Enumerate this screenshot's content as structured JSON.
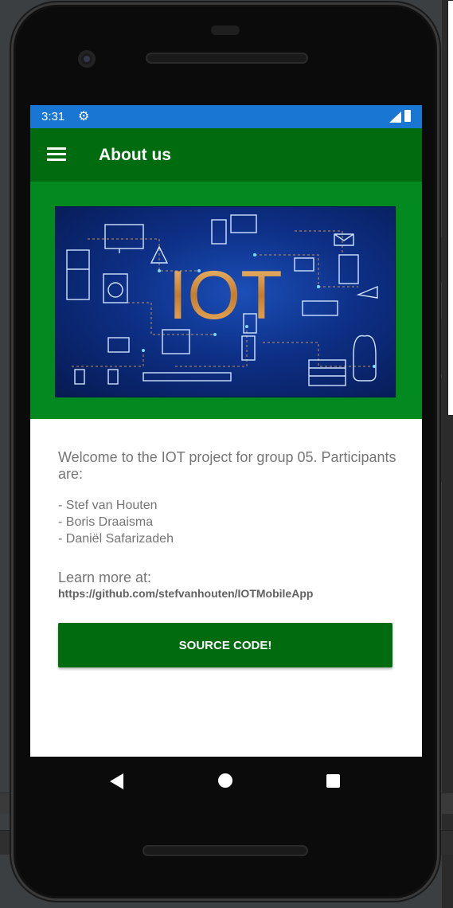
{
  "status": {
    "time": "3:31",
    "icons": [
      "gear-icon",
      "signal-icon",
      "battery-icon"
    ]
  },
  "appbar": {
    "title": "About us",
    "menu_icon": "menu-icon"
  },
  "banner": {
    "image_text": "IOT",
    "bg_color": "#028a21"
  },
  "content": {
    "welcome": "Welcome to the IOT project for group 05. Participants are:",
    "participants": [
      "- Stef van Houten",
      "- Boris Draaisma",
      "- Daniël Safarizadeh"
    ],
    "learn_more": "Learn more at:",
    "url": "https://github.com/stefvanhouten/IOTMobileApp",
    "button_label": "SOURCE CODE!"
  },
  "colors": {
    "status_bar": "#1976d2",
    "app_bar": "#006b0f",
    "button": "#006b0f"
  },
  "navbar": {
    "icons": [
      "back-icon",
      "home-icon",
      "recents-icon"
    ]
  }
}
